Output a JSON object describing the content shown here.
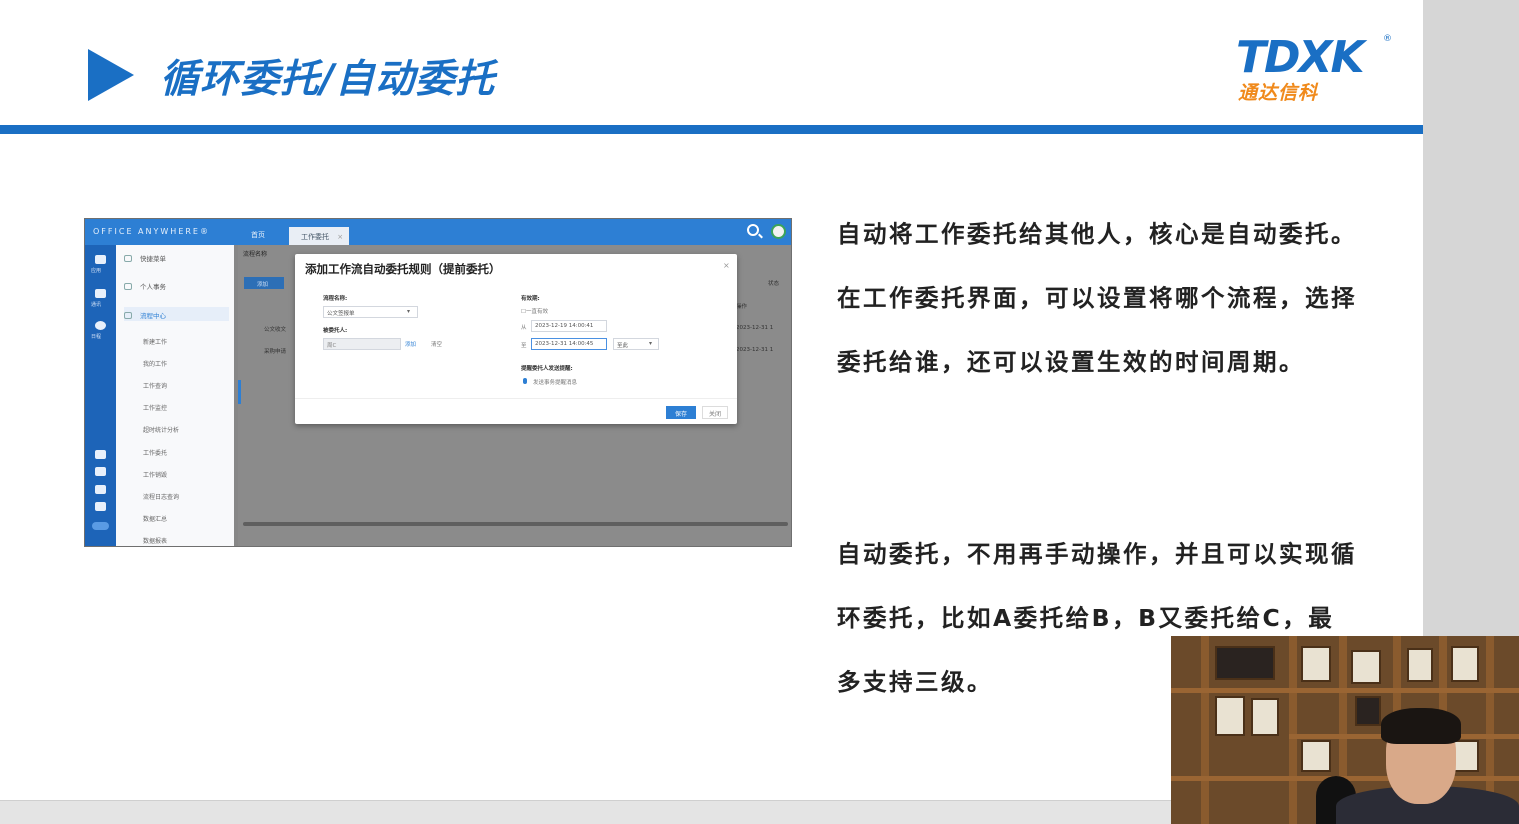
{
  "slide": {
    "title": "循环委托/自动委托",
    "logo": {
      "mark": "TDXK",
      "reg": "®",
      "subtitle": "通达信科"
    },
    "paragraph_1": "自动将工作委托给其他人，核心是自动委托。在工作委托界面，可以设置将哪个流程，选择委托给谁，还可以设置生效的时间周期。",
    "paragraph_2": "自动委托，不用再手动操作，并且可以实现循环委托，比如A委托给B，B又委托给C，最多支持三级。"
  },
  "app": {
    "brand": "OFFICE ANYWHERE®",
    "tabs": [
      {
        "label": "首页"
      },
      {
        "label": "工作委托",
        "close": "×"
      }
    ],
    "rail": [
      "应用",
      "通讯",
      "日程"
    ],
    "menu": [
      {
        "label": "快捷菜单"
      },
      {
        "label": "个人事务"
      },
      {
        "label": "流程中心"
      }
    ],
    "submenu": [
      "新建工作",
      "我的工作",
      "工作查询",
      "工作监控",
      "超时统计分析",
      "工作委托",
      "工作销毁",
      "流程日志查询",
      "数据汇总",
      "数据报表"
    ],
    "main": {
      "header_label": "流程名称",
      "add_button": "添加",
      "rows": [
        {
          "name": "公文收文",
          "date": "2023-12-31 1"
        },
        {
          "name": "采购申请",
          "date": "2023-12-31 1"
        }
      ],
      "right_labels": [
        "操作",
        "状态"
      ]
    },
    "dialog": {
      "title": "添加工作流自动委托规则（提前委托）",
      "close": "×",
      "flow_name_label": "流程名称:",
      "flow_name_value": "公文签报单",
      "delegatee_label": "被委托人:",
      "delegatee_value": "周C",
      "add_link": "添加",
      "clear_link": "清空",
      "validity_label": "有效期:",
      "forever_option": "一直有效",
      "from_label": "从",
      "from_value": "2023-12-19 14:00:41",
      "to_label": "至",
      "to_value": "2023-12-31 14:00:45",
      "to_extra": "至此",
      "notify_label": "提醒委托人发送提醒:",
      "notify_option": "发送事务提醒消息",
      "save_button": "保存",
      "close_button": "关闭"
    }
  }
}
